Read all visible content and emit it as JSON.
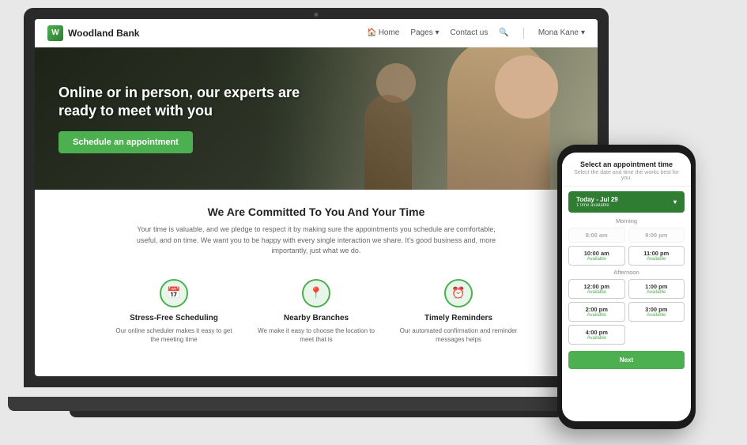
{
  "brand": {
    "name": "Woodland Bank",
    "logo_letter": "W"
  },
  "navbar": {
    "home_label": "Home",
    "pages_label": "Pages",
    "contact_label": "Contact us",
    "user_name": "Mona Kane"
  },
  "hero": {
    "title": "Online or in person, our experts are ready to meet with you",
    "cta_button": "Schedule an appointment"
  },
  "commitment": {
    "section_title": "We Are Committed To You And Your Time",
    "section_text": "Your time is valuable, and we pledge to respect it by making sure the appointments you schedule are comfortable, useful, and on time. We want you to be happy with every single interaction we share. It's good business and, more importantly, just what we do."
  },
  "features": [
    {
      "icon": "📅",
      "title": "Stress-Free Scheduling",
      "text": "Our online scheduler makes it easy to get the meeting time"
    },
    {
      "icon": "📍",
      "title": "Nearby Branches",
      "text": "We make it easy to choose the location to meet that is"
    },
    {
      "icon": "⏰",
      "title": "Timely Reminders",
      "text": "Our automated confirmation and reminder messages helps"
    }
  ],
  "phone": {
    "title": "Select an appointment time",
    "subtitle": "Select the date and time the works best for you.",
    "date_selector": "Today - Jul 29",
    "date_sub": "1 time available",
    "sections": [
      {
        "label": "Morning",
        "slots": [
          {
            "time": "8:00 am",
            "status": "",
            "disabled": true
          },
          {
            "time": "9:00 pm",
            "status": "",
            "disabled": true
          },
          {
            "time": "10:00 am",
            "status": "Available",
            "disabled": false
          },
          {
            "time": "11:00 pm",
            "status": "Available",
            "disabled": false
          }
        ]
      },
      {
        "label": "Afternoon",
        "slots": [
          {
            "time": "12:00 pm",
            "status": "Available",
            "disabled": false
          },
          {
            "time": "1:00 pm",
            "status": "Available",
            "disabled": false
          },
          {
            "time": "2:00 pm",
            "status": "Available",
            "disabled": false
          },
          {
            "time": "3:00 pm",
            "status": "Available",
            "disabled": false
          },
          {
            "time": "4:00 pm",
            "status": "Available",
            "disabled": false
          }
        ]
      }
    ],
    "next_button": "Next"
  }
}
